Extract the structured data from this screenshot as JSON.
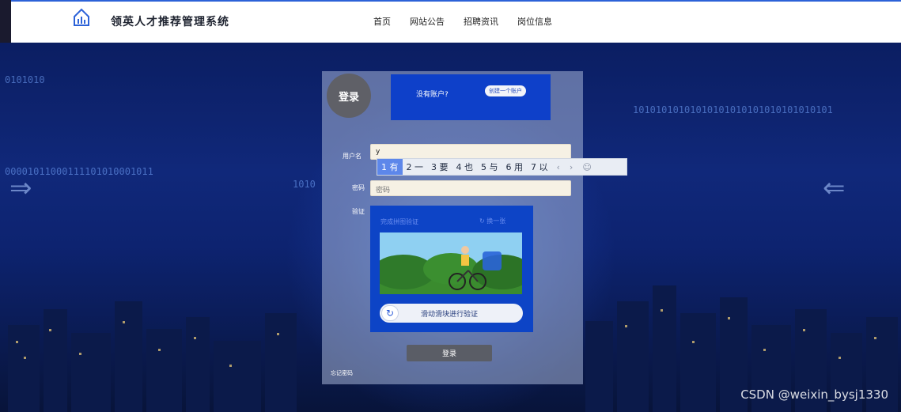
{
  "header": {
    "site_title": "领英人才推荐管理系统",
    "nav": [
      "首页",
      "网站公告",
      "招聘资讯",
      "岗位信息"
    ]
  },
  "background": {
    "binary_left": "0000101100011110101000101​1",
    "binary_top_left": "0101010",
    "binary_right": "10101010101010101010101010101010101",
    "binary_mid": "1010"
  },
  "login": {
    "circle_label": "登录",
    "no_account": "没有账户?",
    "create_account": "创建一个账户",
    "username_label": "用户名",
    "username_value": "y",
    "password_label": "密码",
    "password_placeholder": "密码",
    "captcha_label": "验证",
    "captcha_title": "完成拼图验证",
    "captcha_refresh": "换一张",
    "slider_text": "滑动滑块进行验证",
    "submit_label": "登录",
    "forgot_label": "忘记密码"
  },
  "ime": {
    "candidates": [
      "1 有",
      "2 一",
      "3 要",
      "4 也",
      "5 与",
      "6 用",
      "7 以"
    ],
    "prev": "‹",
    "next": "›",
    "emoji": "☺"
  },
  "watermark": "CSDN @weixin_bysj1330"
}
